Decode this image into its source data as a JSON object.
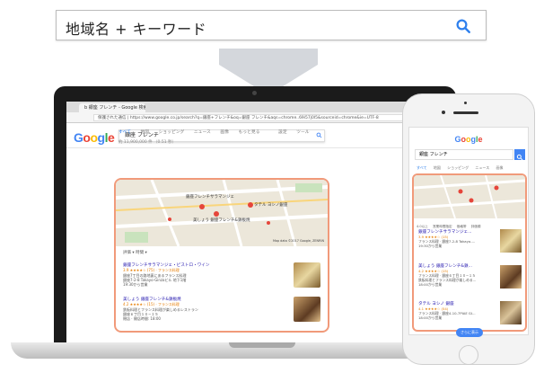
{
  "search_bar": {
    "query": "地域名 + キーワード",
    "search_icon": "search-icon"
  },
  "browser": {
    "tab_title": "b 銀座 フレンチ - Google 検索",
    "url": "保護された通信 | https://www.google.co.jp/search?q=銀座+フレンチ&oq=銀座 フレンチ&aqs=chrome..69i57j0l5&sourceid=chrome&ie=UTF-8"
  },
  "google": {
    "logo": "Google",
    "query": "銀座 フレンチ",
    "nav": [
      "すべて",
      "地図",
      "ショッピング",
      "ニュース",
      "画像",
      "もっと見る",
      "設定",
      "ツール"
    ],
    "result_count": "約 11,900,000 件 （0.51 秒）",
    "filters": "評価 ▾   時間 ▾",
    "map_labels": [
      "銀座フレンチサラマンジェ",
      "美しょう 銀座フレンチ&鉄板焼",
      "タテル ヨシノ銀座"
    ],
    "map_credit": "Map data ©2017 Google, ZENRIN",
    "results": [
      {
        "name": "銀座フレンチサラマンジェ・ビストロ・ワイン",
        "meta": "3.9 ★★★★☆ (75) · フランス料理",
        "sub1": "銀座7丁目の路地裏にあるフランス料理",
        "sub2": "銀座7-2-8 Takayo-Ginzaビル 地下1階",
        "sub3": "19:30から営業"
      },
      {
        "name": "美しょう 銀座フレンチ&鉄板焼",
        "meta": "4.2 ★★★★☆ (15) · フランス料理",
        "sub1": "鉄板料理とフランス料理が楽しめるレストラン",
        "sub2": "銀座６丁目１０−１５",
        "sub3": "閉店 · 開店時間: 18:00"
      }
    ]
  },
  "phone": {
    "logo": "Google",
    "query": "銀座 フレンチ",
    "nav": [
      "すべて",
      "地図",
      "ショッピング",
      "ニュース",
      "画像"
    ],
    "chips": [
      "4.0以上",
      "営業時間指定",
      "価格帯",
      "評価順",
      "その他",
      "フランス料理"
    ],
    "results": [
      {
        "name": "銀座フレンチサラマンジェ...",
        "meta": "3.9 ★★★★☆ (15)",
        "sub1": "フランス料理 · 銀座7-2-8 Takayo-...",
        "sub2": "19:30から営業"
      },
      {
        "name": "美しょう 銀座フレンチ&鉄...",
        "meta": "4.2 ★★★★☆ (15)",
        "sub1": "フランス料理 · 銀座６丁目１０−１５",
        "sub2": "鉄板料理とフランス料理が楽しめる...",
        "sub3": "18:00から営業"
      },
      {
        "name": "タテル ヨシノ 銀座",
        "meta": "4.1 ★★★★☆ (54)",
        "sub1": "フランス料理 · 銀座4-10-7PIAE GI...",
        "sub2": "18:00から営業"
      }
    ],
    "more": "さらに表示"
  },
  "colors": {
    "accent_blue": "#4285f4",
    "highlight": "#f19a7a",
    "arrow": "#d4d7dc"
  }
}
